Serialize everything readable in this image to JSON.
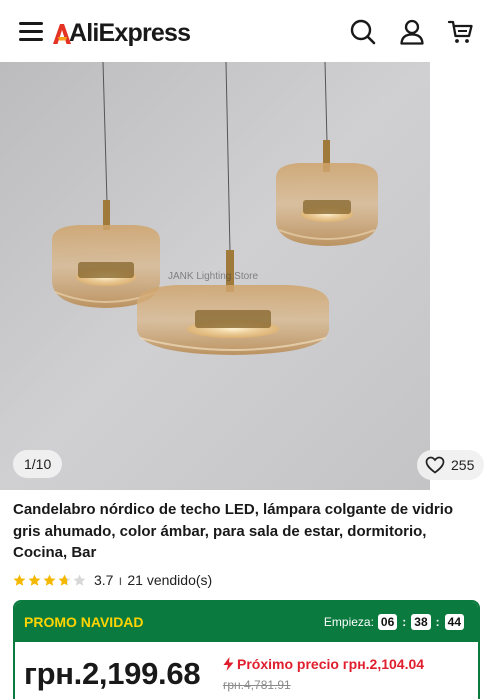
{
  "header": {
    "logo_text": "AliExpress",
    "icons": [
      "menu-icon",
      "search-icon",
      "user-icon",
      "cart-icon"
    ]
  },
  "gallery": {
    "counter": "1/10",
    "wishlist_count": "255",
    "watermark": "JANK Lighting Store"
  },
  "product": {
    "title": "Candelabro nórdico de techo LED, lámpara colgante de vidrio gris ahumado, color ámbar, para sala de estar, dormitorio, Cocina, Bar",
    "rating": "3.7",
    "separator": "ı",
    "sold": "21 vendido(s)",
    "stars": 3.7
  },
  "promo": {
    "label": "PROMO NAVIDAD",
    "starts_label": "Empieza:",
    "hours": "06",
    "minutes": "38",
    "seconds": "44",
    "price": "грн.2,199.68",
    "next_price": "Próximo precio грн.2,104.04",
    "old_price": "грн.4,781.91"
  },
  "colors": {
    "promo_green": "#0a7a3e",
    "promo_yellow": "#ffd400",
    "accent_red": "#e01e2d",
    "star_gold": "#f5b800"
  }
}
